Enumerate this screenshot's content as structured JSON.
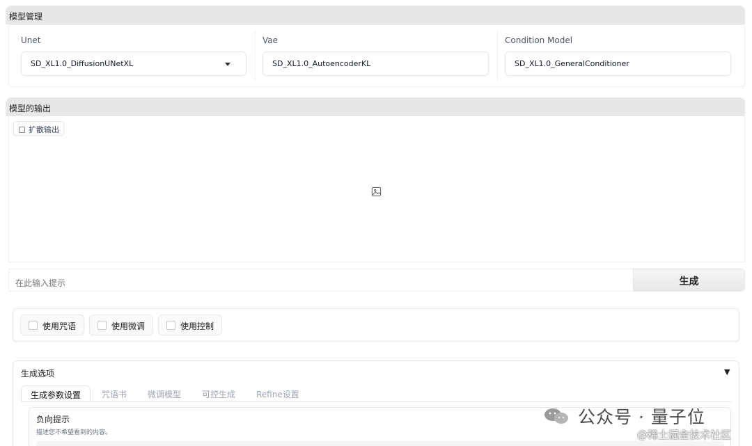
{
  "model_section": {
    "title": "模型管理",
    "unet": {
      "label": "Unet",
      "value": "SD_XL1.0_DiffusionUNetXL"
    },
    "vae": {
      "label": "Vae",
      "value": "SD_XL1.0_AutoencoderKL"
    },
    "condition": {
      "label": "Condition Model",
      "value": "SD_XL1.0_GeneralConditioner"
    }
  },
  "output_section": {
    "title": "模型的输出",
    "tag_label": "扩散输出",
    "prompt_placeholder": "在此输入提示",
    "generate_label": "生成"
  },
  "checkboxes": [
    {
      "label": "使用咒语",
      "checked": false
    },
    {
      "label": "使用微调",
      "checked": false
    },
    {
      "label": "使用控制",
      "checked": false
    }
  ],
  "options": {
    "title": "生成选项",
    "toggle": "▼",
    "tabs": [
      "生成参数设置",
      "咒语书",
      "微调模型",
      "可控生成",
      "Refine设置"
    ],
    "active_tab": 0,
    "negative_prompt": {
      "title": "负向提示",
      "description": "描述您不希望看到的内容。"
    }
  },
  "watermark": {
    "primary": "公众号 · 量子位",
    "secondary": "@稀土掘金技术社区"
  }
}
